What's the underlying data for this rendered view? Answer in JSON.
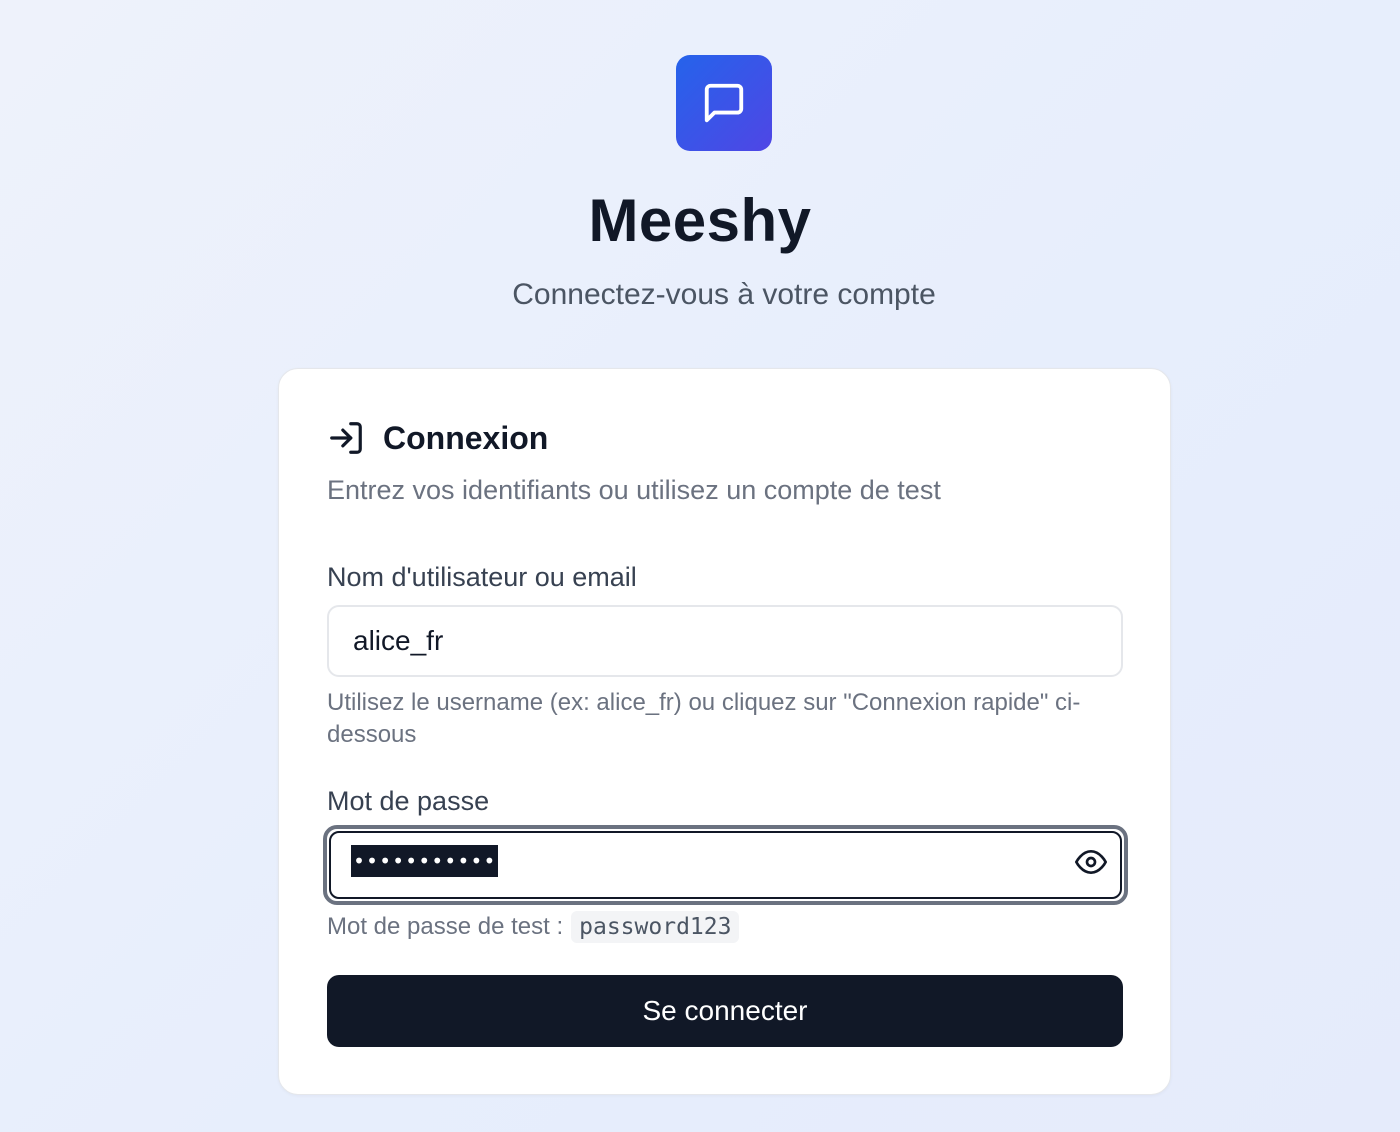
{
  "brand": {
    "name": "Meeshy",
    "tagline": "Connectez-vous à votre compte",
    "logo_icon": "message-square-icon",
    "accent_gradient": [
      "#2563eb",
      "#4f46e5"
    ]
  },
  "card": {
    "icon": "log-in-icon",
    "title": "Connexion",
    "description": "Entrez vos identifiants ou utilisez un compte de test"
  },
  "form": {
    "username": {
      "label": "Nom d'utilisateur ou email",
      "value": "alice_fr",
      "hint": "Utilisez le username (ex: alice_fr) ou cliquez sur \"Connexion rapide\" ci-dessous"
    },
    "password": {
      "label": "Mot de passe",
      "masked_value": "•••••••••••",
      "hint_prefix": "Mot de passe de test :",
      "hint_code": "password123",
      "toggle_icon": "eye-icon"
    },
    "submit_label": "Se connecter"
  },
  "colors": {
    "primary_button": "#111827",
    "muted_text": "#6b7280"
  }
}
